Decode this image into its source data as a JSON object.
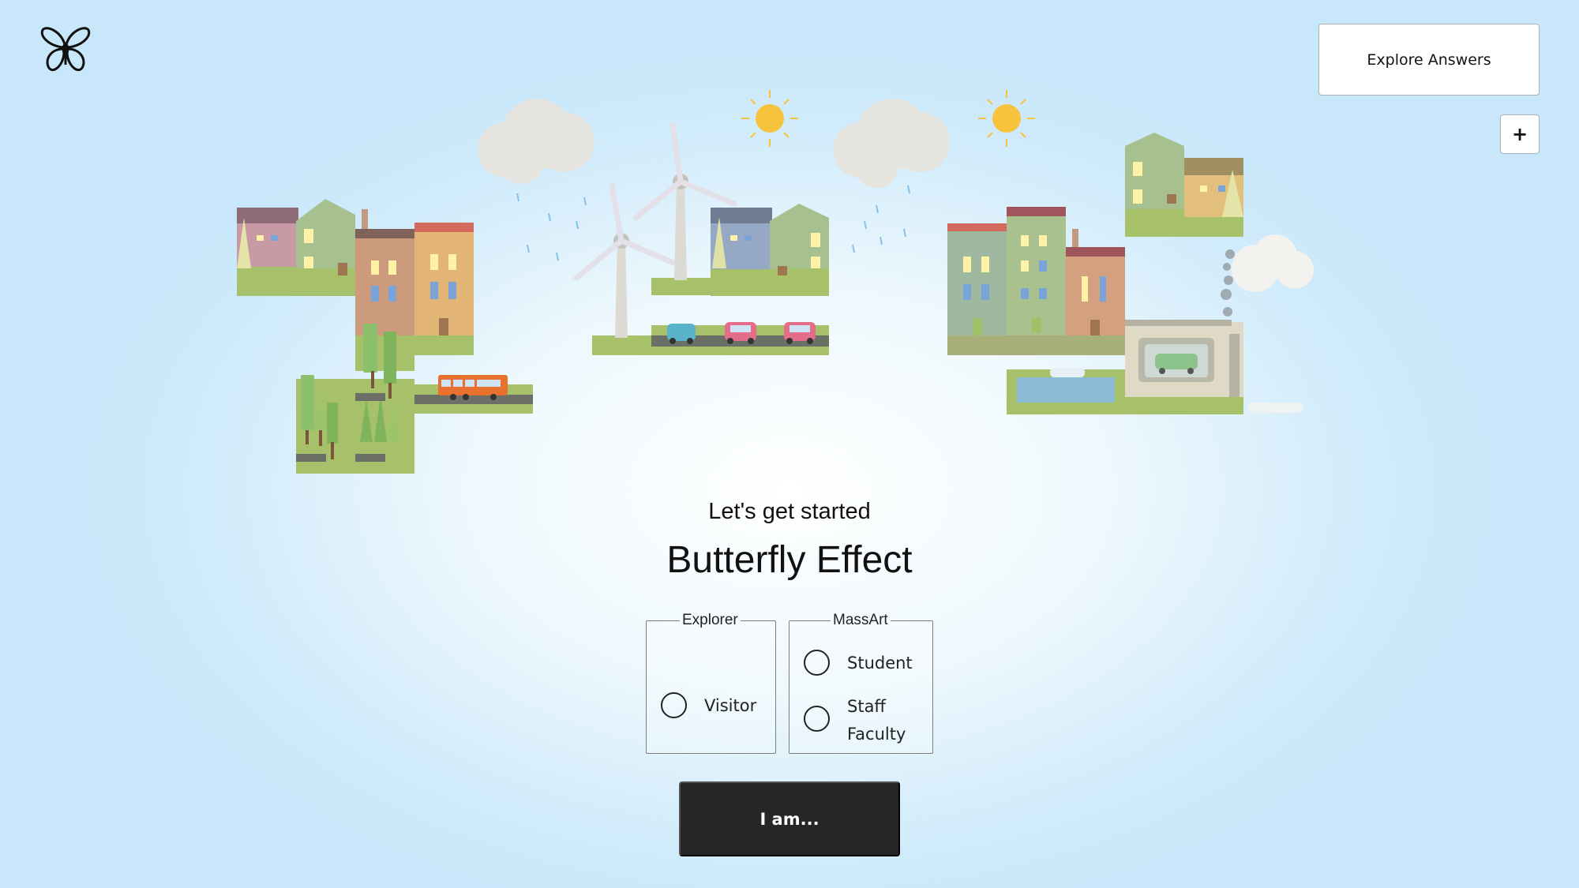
{
  "header": {
    "logo_icon": "butterfly-icon",
    "explore_label": "Explore Answers",
    "expand_label": "+"
  },
  "scene": {
    "description_icons": [
      "cloud-icon",
      "sun-icon",
      "wind-turbine-icon",
      "house-icon",
      "car-icon",
      "bus-icon",
      "tree-icon",
      "factory-icon",
      "river-icon"
    ]
  },
  "intro": {
    "subtitle": "Let's get started",
    "title": "Butterfly Effect"
  },
  "role_form": {
    "explorer_legend": "Explorer",
    "explorer_options": [
      "Visitor"
    ],
    "massart_legend": "MassArt",
    "massart_options": [
      "Student",
      "Staff\nFaculty"
    ],
    "massart_option_lines": [
      [
        "Student"
      ],
      [
        "Staff",
        "Faculty"
      ]
    ],
    "submit_label": "I am..."
  },
  "colors": {
    "button_dark": "#262626",
    "sun": "#f8c33c",
    "grass": "#a7c06a"
  }
}
